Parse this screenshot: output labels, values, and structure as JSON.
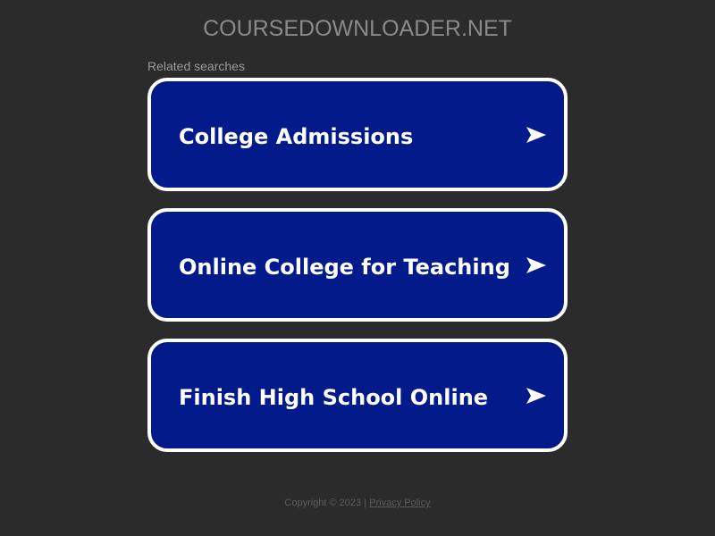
{
  "site": {
    "title": "COURSEDOWNLOADER.NET"
  },
  "related": {
    "label": "Related searches",
    "items": [
      {
        "label": "College Admissions"
      },
      {
        "label": "Online College for Teaching"
      },
      {
        "label": "Finish High School Online"
      }
    ]
  },
  "footer": {
    "copyright": "Copyright © 2023",
    "separator": "|",
    "privacy_label": "Privacy Policy"
  },
  "colors": {
    "background": "#2b2b2b",
    "card_fill": "#021a8a",
    "card_border": "#ffffff"
  }
}
